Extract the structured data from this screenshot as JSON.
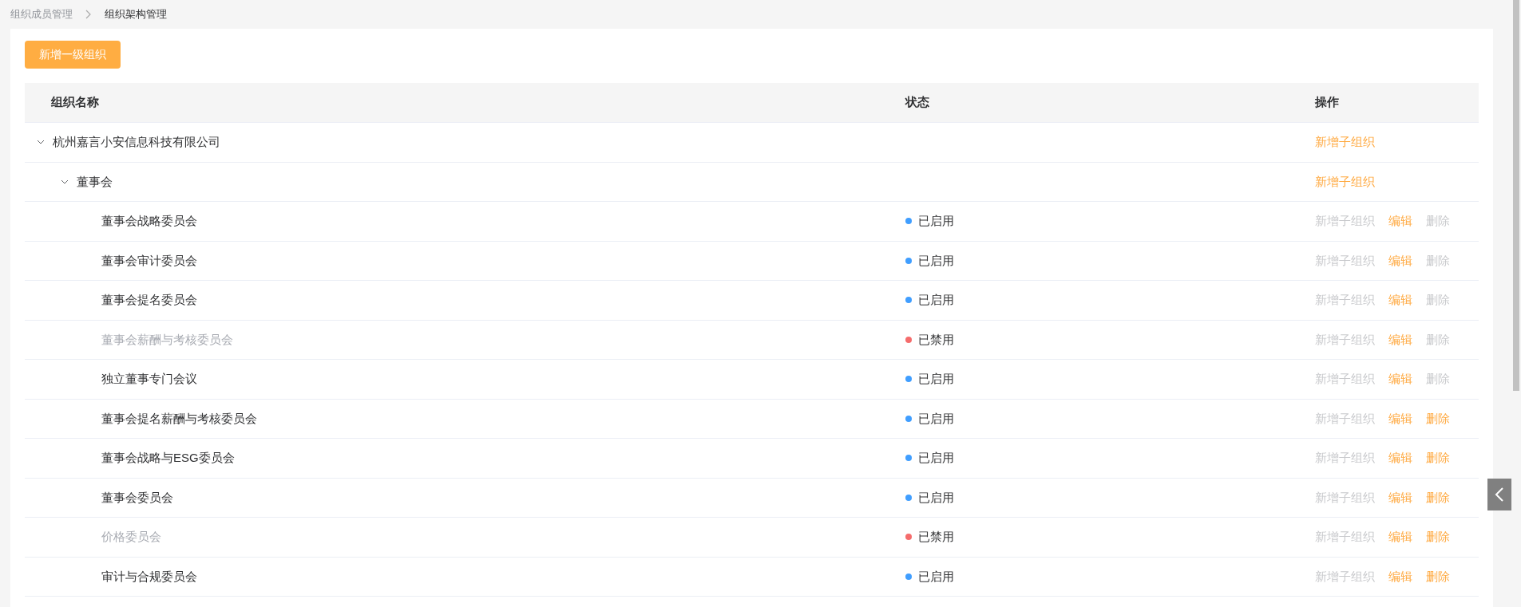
{
  "breadcrumb": [
    {
      "label": "组织成员管理",
      "current": false
    },
    {
      "label": "组织架构管理",
      "current": true
    }
  ],
  "add_button": "新增一级组织",
  "table": {
    "columns": [
      "组织名称",
      "状态",
      "操作"
    ],
    "rows": [
      {
        "name": "杭州嘉言小安信息科技有限公司",
        "expanded": true,
        "disabled": false,
        "actions": [
          {
            "label": "新增子组织",
            "disabled": false
          }
        ],
        "children": [
          {
            "name": "董事会",
            "expanded": true,
            "disabled": false,
            "actions": [
              {
                "label": "新增子组织",
                "disabled": false
              }
            ],
            "children": [
              {
                "name": "董事会战略委员会",
                "disabled": false,
                "status": {
                  "label": "已启用",
                  "color": "#409eff"
                },
                "actions": [
                  {
                    "label": "新增子组织",
                    "disabled": true
                  },
                  {
                    "label": "编辑",
                    "disabled": false
                  },
                  {
                    "label": "删除",
                    "disabled": true
                  }
                ]
              },
              {
                "name": "董事会审计委员会",
                "disabled": false,
                "status": {
                  "label": "已启用",
                  "color": "#409eff"
                },
                "actions": [
                  {
                    "label": "新增子组织",
                    "disabled": true
                  },
                  {
                    "label": "编辑",
                    "disabled": false
                  },
                  {
                    "label": "删除",
                    "disabled": true
                  }
                ]
              },
              {
                "name": "董事会提名委员会",
                "disabled": false,
                "status": {
                  "label": "已启用",
                  "color": "#409eff"
                },
                "actions": [
                  {
                    "label": "新增子组织",
                    "disabled": true
                  },
                  {
                    "label": "编辑",
                    "disabled": false
                  },
                  {
                    "label": "删除",
                    "disabled": true
                  }
                ]
              },
              {
                "name": "董事会薪酬与考核委员会",
                "disabled": true,
                "status": {
                  "label": "已禁用",
                  "color": "#f56c6c"
                },
                "actions": [
                  {
                    "label": "新增子组织",
                    "disabled": true
                  },
                  {
                    "label": "编辑",
                    "disabled": false
                  },
                  {
                    "label": "删除",
                    "disabled": true
                  }
                ]
              },
              {
                "name": "独立董事专门会议",
                "disabled": false,
                "status": {
                  "label": "已启用",
                  "color": "#409eff"
                },
                "actions": [
                  {
                    "label": "新增子组织",
                    "disabled": true
                  },
                  {
                    "label": "编辑",
                    "disabled": false
                  },
                  {
                    "label": "删除",
                    "disabled": true
                  }
                ]
              },
              {
                "name": "董事会提名薪酬与考核委员会",
                "disabled": false,
                "status": {
                  "label": "已启用",
                  "color": "#409eff"
                },
                "actions": [
                  {
                    "label": "新增子组织",
                    "disabled": true
                  },
                  {
                    "label": "编辑",
                    "disabled": false
                  },
                  {
                    "label": "删除",
                    "disabled": false
                  }
                ]
              },
              {
                "name": "董事会战略与ESG委员会",
                "disabled": false,
                "status": {
                  "label": "已启用",
                  "color": "#409eff"
                },
                "actions": [
                  {
                    "label": "新增子组织",
                    "disabled": true
                  },
                  {
                    "label": "编辑",
                    "disabled": false
                  },
                  {
                    "label": "删除",
                    "disabled": false
                  }
                ]
              },
              {
                "name": "董事会委员会",
                "disabled": false,
                "status": {
                  "label": "已启用",
                  "color": "#409eff"
                },
                "actions": [
                  {
                    "label": "新增子组织",
                    "disabled": true
                  },
                  {
                    "label": "编辑",
                    "disabled": false
                  },
                  {
                    "label": "删除",
                    "disabled": false
                  }
                ]
              },
              {
                "name": "价格委员会",
                "disabled": true,
                "status": {
                  "label": "已禁用",
                  "color": "#f56c6c"
                },
                "actions": [
                  {
                    "label": "新增子组织",
                    "disabled": true
                  },
                  {
                    "label": "编辑",
                    "disabled": false
                  },
                  {
                    "label": "删除",
                    "disabled": false
                  }
                ]
              },
              {
                "name": "审计与合规委员会",
                "disabled": false,
                "status": {
                  "label": "已启用",
                  "color": "#409eff"
                },
                "actions": [
                  {
                    "label": "新增子组织",
                    "disabled": true
                  },
                  {
                    "label": "编辑",
                    "disabled": false
                  },
                  {
                    "label": "删除",
                    "disabled": false
                  }
                ]
              }
            ]
          }
        ]
      }
    ]
  }
}
